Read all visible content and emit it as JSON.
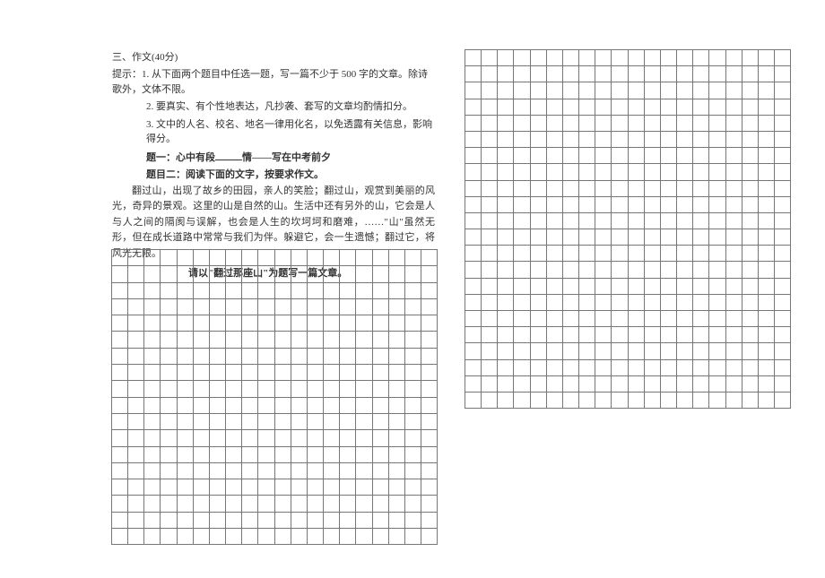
{
  "section_title": "三、作文(40分)",
  "hint_prefix": "提示：",
  "hints": {
    "h1": "1. 从下面两个题目中任选一题，写一篇不少于 500 字的文章。除诗歌外，文体不限。",
    "h2": "2. 要真实、有个性地表达，凡抄袭、套写的文章均酌情扣分。",
    "h3": "3. 文中的人名、校名、地名一律用化名，以免透露有关信息，影响得分。"
  },
  "topic1_prefix": "题一：心中有段",
  "topic1_suffix": "情——写在中考前夕",
  "topic2": "题目二：阅读下面的文字，按要求作文。",
  "passage": "翻过山，出现了故乡的田园，亲人的笑脸；翻过山，观赏到美丽的风光，奇异的景观。这里的山是自然的山。生活中还有另外的山，它会是人与人之间的隔阂与误解，也会是人生的坎坷坷和磨难，……\"山\"虽然无形，但在成长道路中常常与我们为伴。躲避它，会一生遗憾；翻过它，将风光无限。",
  "final_instruction": "请以\"翻过那座山\"为题写一篇文章。",
  "grid": {
    "left": {
      "rows": 18,
      "cols": 20
    },
    "right": {
      "rows": 22,
      "cols": 20
    }
  }
}
